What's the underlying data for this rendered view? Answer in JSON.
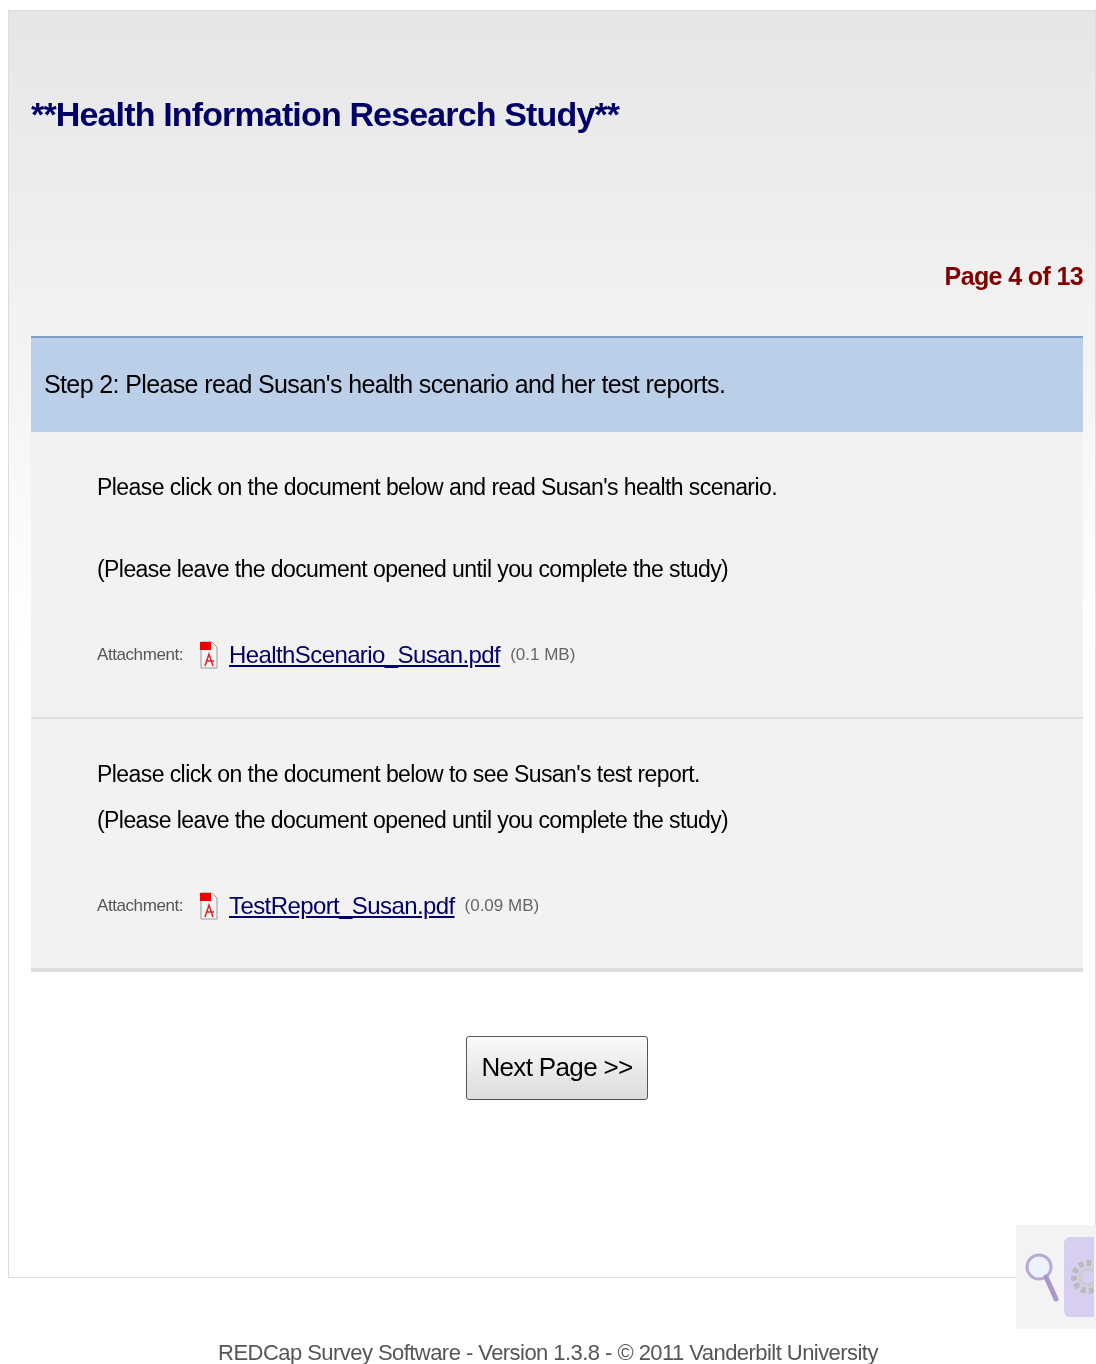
{
  "survey_title": "**Health Information Research Study**",
  "page_indicator": "Page 4 of 13",
  "section_header": "Step 2: Please read Susan's health scenario and her test reports.",
  "fields": [
    {
      "paragraphs": [
        [
          "Please click on the document below and read Susan's health scenario."
        ],
        [
          "(Please leave the document opened until you complete the study)"
        ]
      ],
      "attachment": {
        "label": "Attachment:",
        "file": "HealthScenario_Susan.pdf",
        "size": "(0.1 MB)"
      }
    },
    {
      "paragraphs": [
        [
          "Please click on the document below to see Susan's test report.",
          "(Please leave the document opened until you complete the study)"
        ]
      ],
      "attachment": {
        "label": "Attachment:",
        "file": "TestReport_Susan.pdf",
        "size": "(0.09 MB)"
      }
    }
  ],
  "next_button": "Next Page >>",
  "footer": "REDCap Survey Software - Version 1.3.8 - © 2011 Vanderbilt University"
}
